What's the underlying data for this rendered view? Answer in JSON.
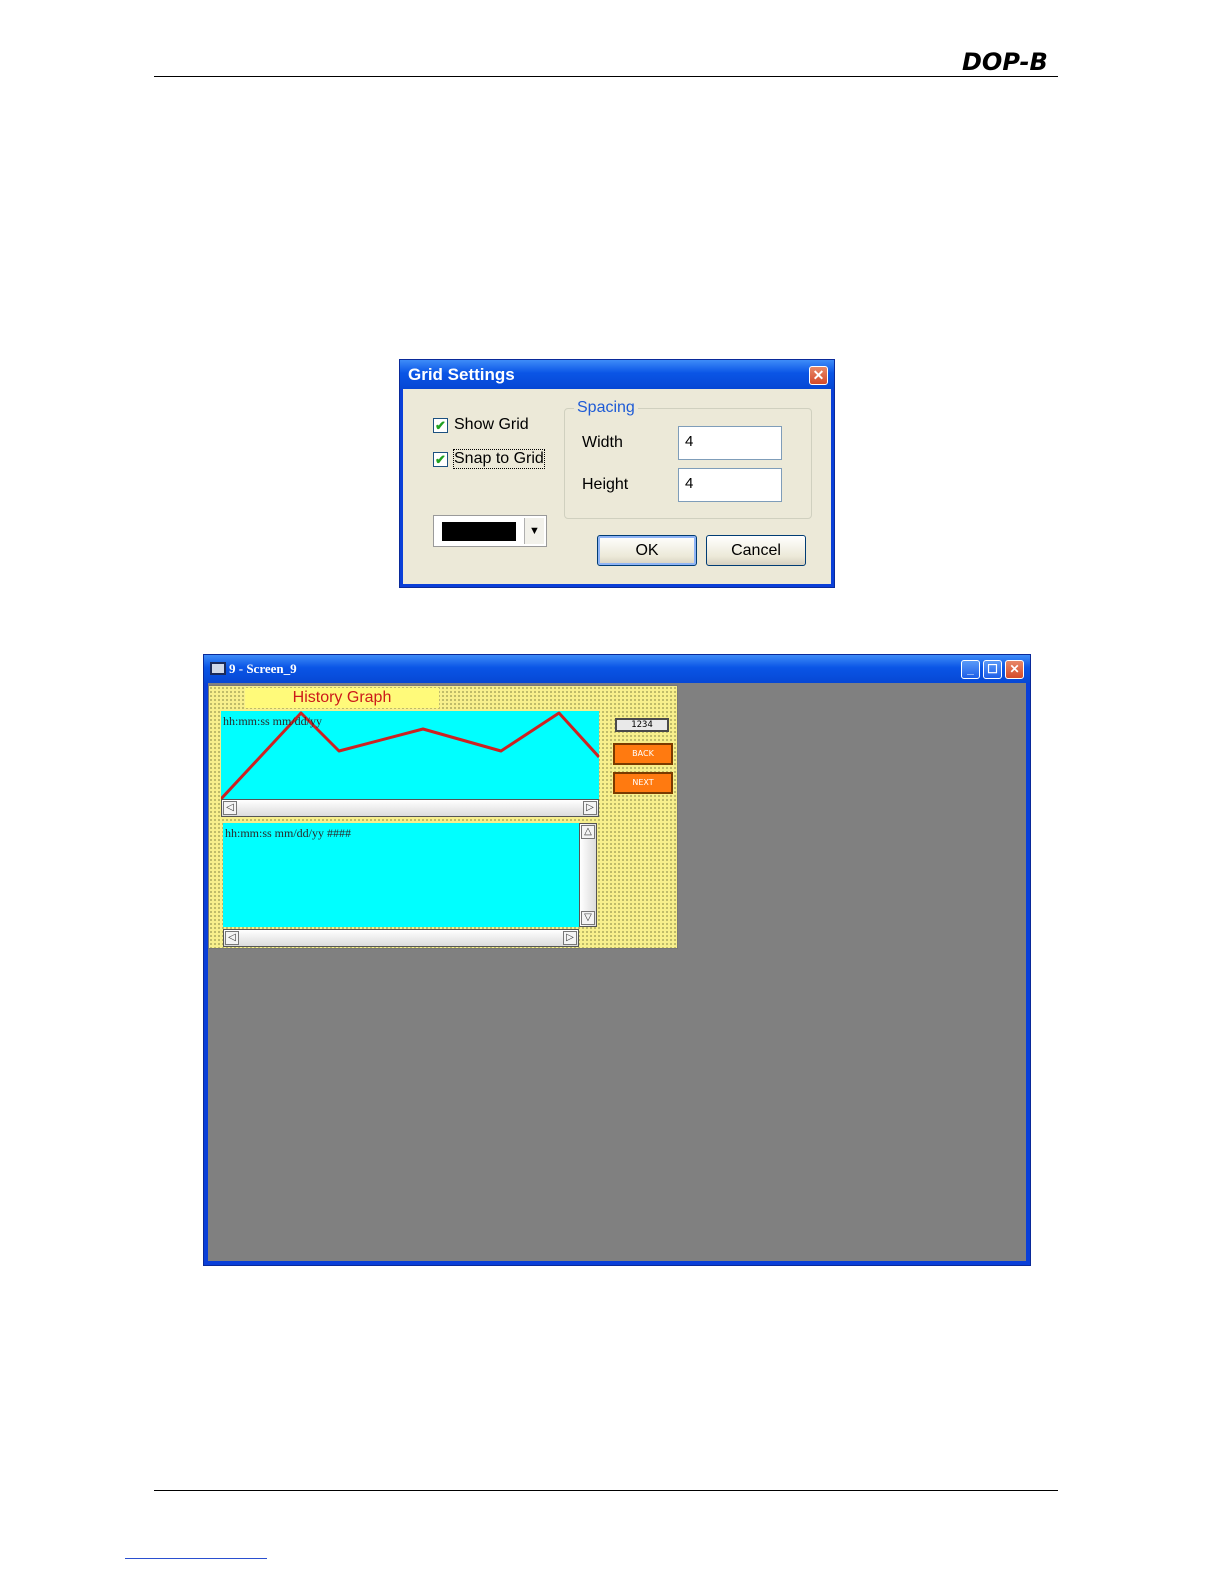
{
  "header": {
    "brand": "DOP-B"
  },
  "dialog": {
    "title": "Grid Settings",
    "show_grid_label": "Show Grid",
    "show_grid_checked": true,
    "snap_label": "Snap to Grid",
    "snap_checked": true,
    "grid_color": "#000000",
    "spacing_group": "Spacing",
    "width_label": "Width",
    "width_value": "4",
    "height_label": "Height",
    "height_value": "4",
    "ok_label": "OK",
    "cancel_label": "Cancel"
  },
  "window": {
    "title": "9 - Screen_9",
    "hmi": {
      "title": "History Graph",
      "trend_format": "hh:mm:ss  mm/dd/yy",
      "list_format": "hh:mm:ss  mm/dd/yy  ####",
      "numeric_display": "1234",
      "back_label": "BACK",
      "next_label": "NEXT"
    }
  },
  "colors": {
    "hmi_background": "#f7ef8c",
    "graph_background": "#00ffff",
    "trend_line": "#cc2222",
    "button": "#ff7a10",
    "workspace": "#808080"
  }
}
